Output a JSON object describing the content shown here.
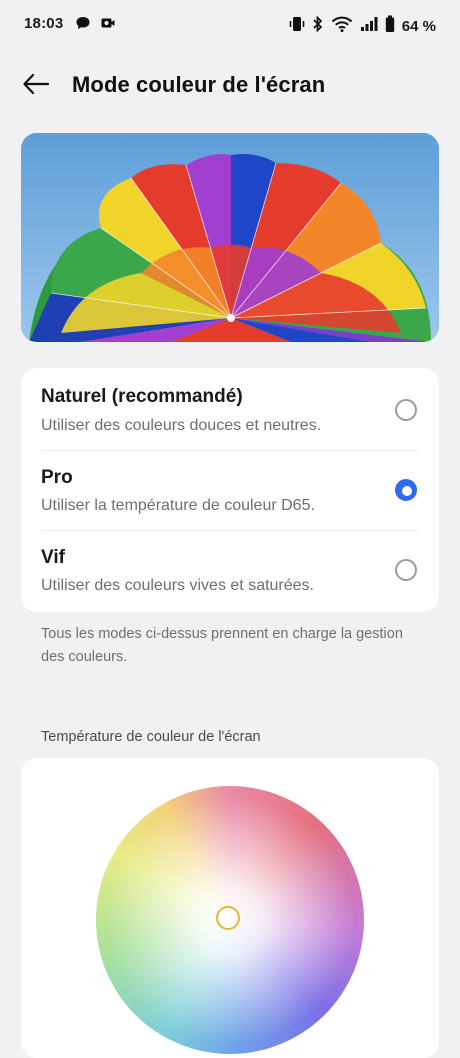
{
  "status_bar": {
    "time": "18:03",
    "left_icons": [
      "chat-bubble-icon",
      "video-recorder-icon"
    ],
    "right_icons": [
      "vibrate-icon",
      "bluetooth-icon",
      "wifi-icon",
      "signal-icon",
      "battery-icon"
    ],
    "battery_text": "64 %"
  },
  "header": {
    "back_icon": "arrow-left-icon",
    "title": "Mode couleur de l'écran"
  },
  "options": [
    {
      "title": "Naturel (recommandé)",
      "subtitle": "Utiliser des couleurs douces et neutres.",
      "selected": false
    },
    {
      "title": "Pro",
      "subtitle": "Utiliser la température de couleur D65.",
      "selected": true
    },
    {
      "title": "Vif",
      "subtitle": "Utiliser des couleurs vives et saturées.",
      "selected": false
    }
  ],
  "footnote": "Tous les modes ci-dessus prennent en charge la gestion des couleurs.",
  "temperature": {
    "section_title": "Température de couleur de l'écran"
  },
  "colors": {
    "accent": "#2f6bf0",
    "background": "#f1f1f3",
    "card": "#ffffff",
    "handle": "#e3b53a"
  }
}
